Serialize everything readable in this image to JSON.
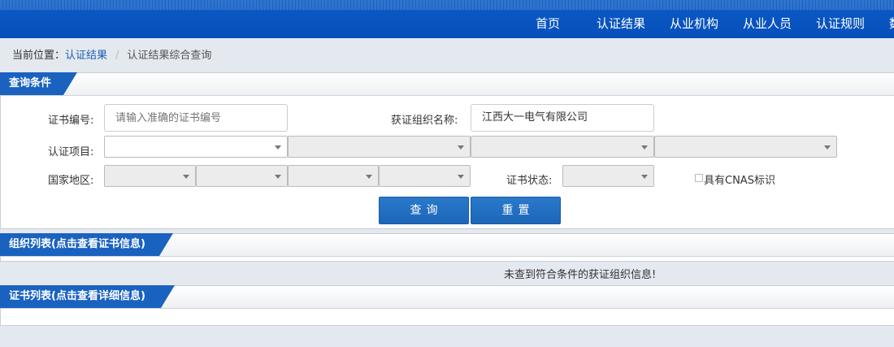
{
  "nav": {
    "items": [
      {
        "label": "首页",
        "name": "nav-home"
      },
      {
        "label": "认证结果",
        "name": "nav-cert-results"
      },
      {
        "label": "从业机构",
        "name": "nav-institutions"
      },
      {
        "label": "从业人员",
        "name": "nav-personnel"
      },
      {
        "label": "认证规则",
        "name": "nav-rules"
      },
      {
        "label": "数",
        "name": "nav-data"
      }
    ]
  },
  "breadcrumb": {
    "prefix": "当前位置：",
    "link": "认证结果",
    "separator": "/",
    "current": "认证结果综合查询"
  },
  "query_panel": {
    "title": "查询条件",
    "cert_no_label": "证书编号:",
    "cert_no_placeholder": "请输入准确的证书编号",
    "org_name_label": "获证组织名称:",
    "org_name_value": "江西大一电气有限公司",
    "cert_project_label": "认证项目:",
    "region_label": "国家地区:",
    "cert_status_label": "证书状态:",
    "cnas_label": "具有CNAS标识",
    "query_button": "查询",
    "reset_button": "重置"
  },
  "org_list": {
    "title": "组织列表(点击查看证书信息)",
    "empty_message": "未查到符合条件的获证组织信息!"
  },
  "cert_list": {
    "title": "证书列表(点击查看详细信息)"
  },
  "colors": {
    "nav_blue": "#0550bc",
    "tab_blue": "#1a62c0",
    "button_blue": "#1d66b8",
    "link_blue": "#1c5fb5"
  }
}
